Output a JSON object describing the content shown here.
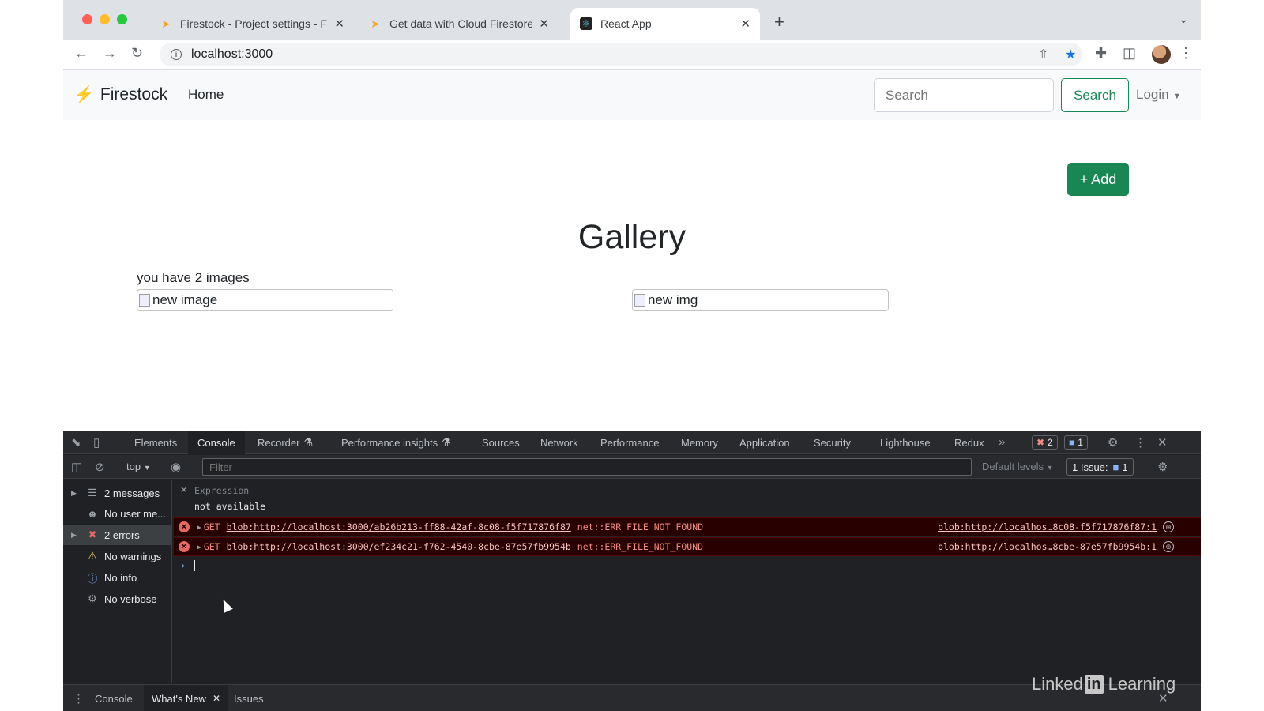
{
  "browser": {
    "tabs": [
      {
        "title": "Firestock - Project settings - F",
        "favicon": "firebase-icon"
      },
      {
        "title": "Get data with Cloud Firestore",
        "favicon": "firebase-icon"
      },
      {
        "title": "React App",
        "favicon": "react-icon"
      }
    ],
    "url": "localhost:3000"
  },
  "app": {
    "brand": "Firestock",
    "nav_home": "Home",
    "search_placeholder": "Search",
    "search_button": "Search",
    "login": "Login",
    "add_button": "+ Add",
    "title": "Gallery",
    "count_text": "you have 2 images",
    "images": [
      {
        "alt": "new image"
      },
      {
        "alt": "new img"
      }
    ]
  },
  "devtools": {
    "tabs": [
      "Elements",
      "Console",
      "Recorder",
      "Performance insights",
      "Sources",
      "Network",
      "Performance",
      "Memory",
      "Application",
      "Security",
      "Lighthouse",
      "Redux"
    ],
    "active_tab": "Console",
    "error_count": "2",
    "message_count": "1",
    "context": "top",
    "filter_placeholder": "Filter",
    "levels": "Default levels",
    "issues_label": "1 Issue:",
    "issues_count": "1",
    "sidebar": [
      {
        "label": "2 messages",
        "icon": "list-icon"
      },
      {
        "label": "No user me...",
        "icon": "user-icon"
      },
      {
        "label": "2 errors",
        "icon": "error-icon"
      },
      {
        "label": "No warnings",
        "icon": "warning-icon"
      },
      {
        "label": "No info",
        "icon": "info-icon"
      },
      {
        "label": "No verbose",
        "icon": "bug-icon"
      }
    ],
    "expression": {
      "label": "Expression",
      "value": "not available"
    },
    "errors": [
      {
        "method": "GET",
        "url": "blob:http://localhost:3000/ab26b213-ff88-42af-8c08-f5f717876f87",
        "code": "net::ERR_FILE_NOT_FOUND",
        "source": "blob:http://localhos…8c08-f5f717876f87:1"
      },
      {
        "method": "GET",
        "url": "blob:http://localhost:3000/ef234c21-f762-4540-8cbe-87e57fb9954b",
        "code": "net::ERR_FILE_NOT_FOUND",
        "source": "blob:http://localhos…8cbe-87e57fb9954b:1"
      }
    ],
    "drawer_tabs": [
      "Console",
      "What's New",
      "Issues"
    ]
  },
  "watermark": {
    "pre": "Linked",
    "in": "in",
    "post": "Learning"
  },
  "colors": {
    "accent_green": "#198754",
    "error_bg": "#290000",
    "error_text": "#f28b82"
  }
}
